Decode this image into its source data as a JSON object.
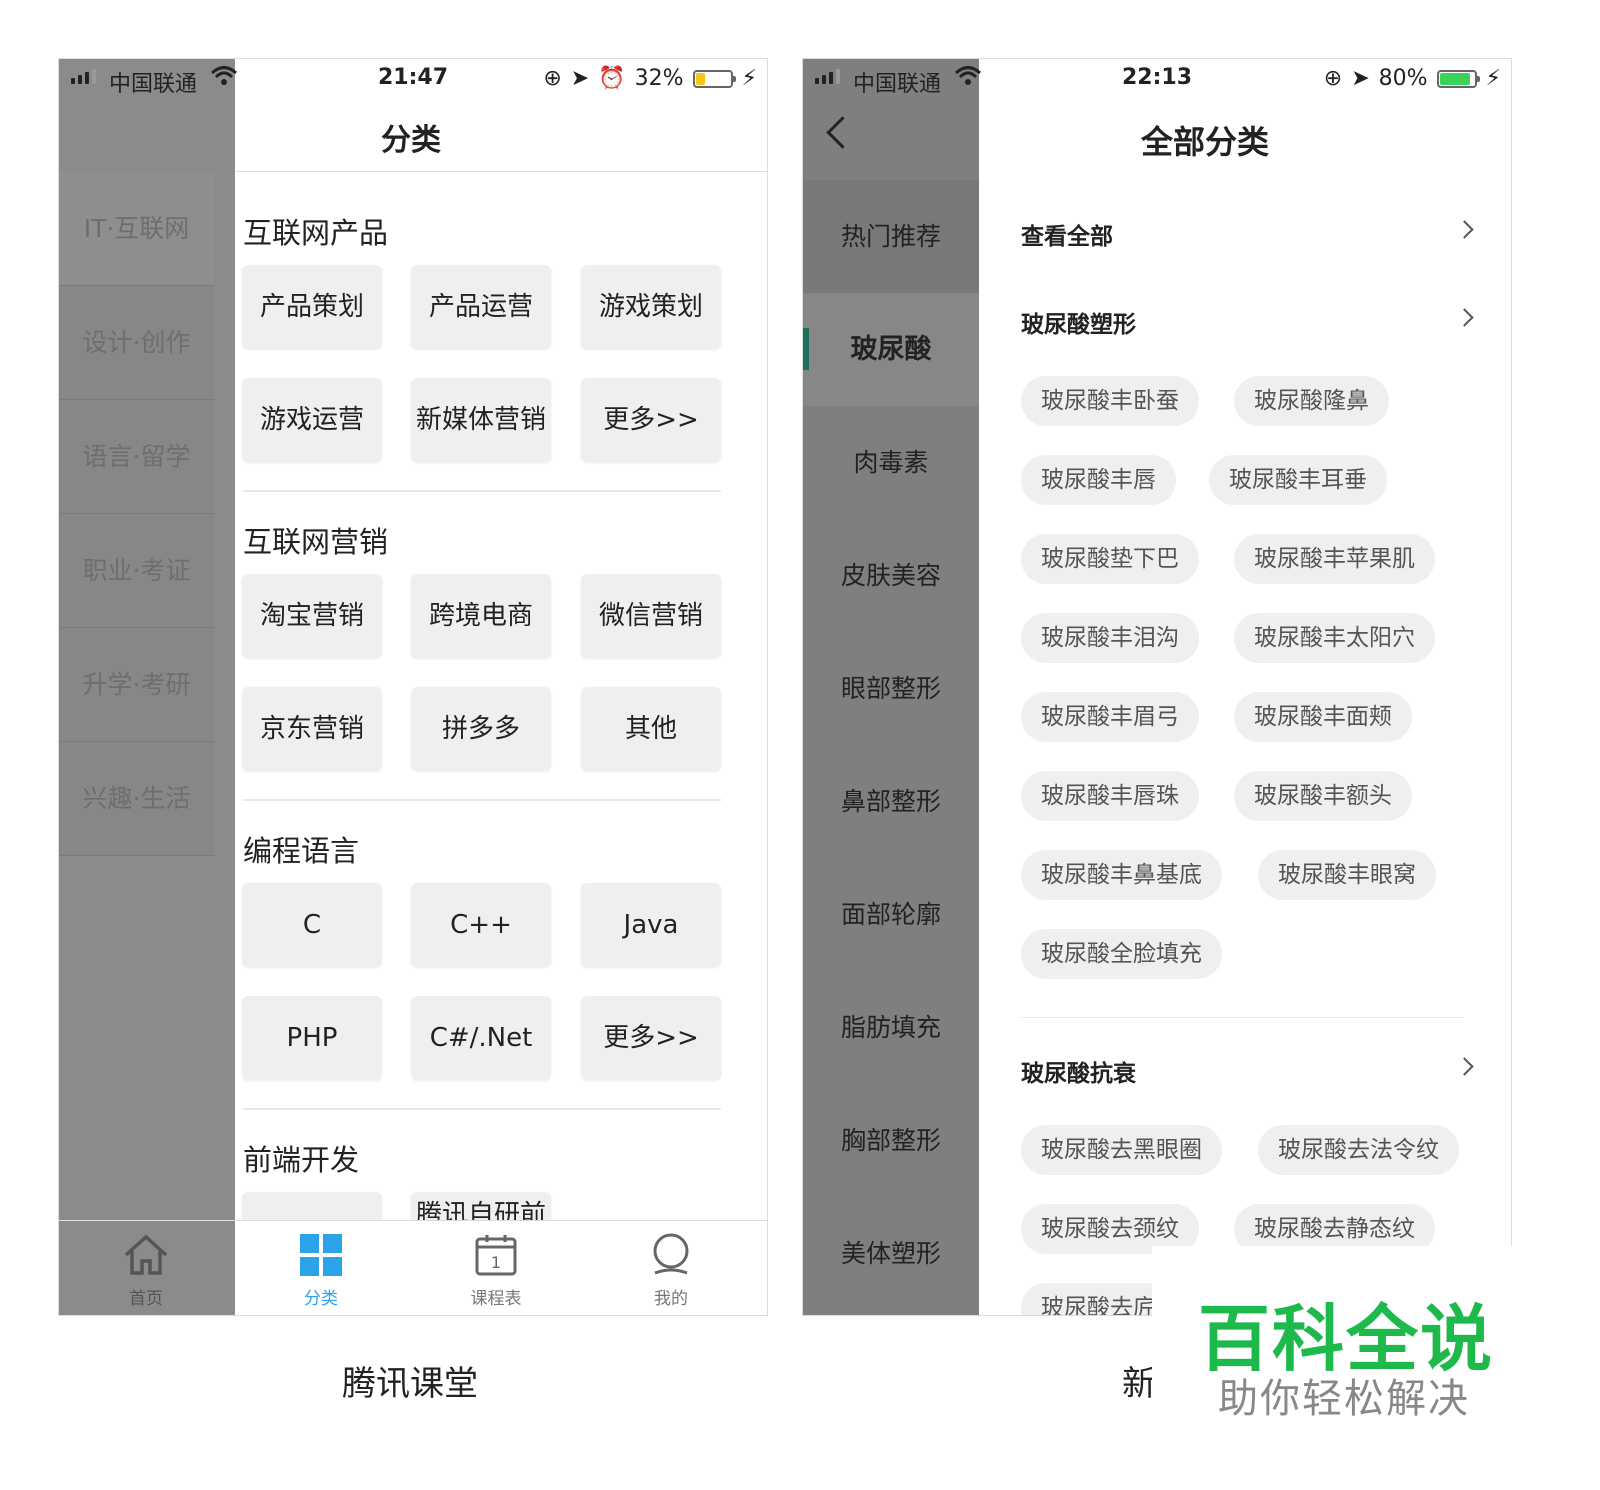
{
  "phoneA": {
    "status": {
      "carrier": "中国联通",
      "time": "21:47",
      "battery": "32%",
      "battery_color": "#f5c518"
    },
    "title": "分类",
    "sidebar": [
      "IT·互联网",
      "设计·创作",
      "语言·留学",
      "职业·考证",
      "升学·考研",
      "兴趣·生活"
    ],
    "sections": [
      {
        "title": "互联网产品",
        "items": [
          "产品策划",
          "产品运营",
          "游戏策划",
          "游戏运营",
          "新媒体营销",
          "更多>>"
        ]
      },
      {
        "title": "互联网营销",
        "items": [
          "淘宝营销",
          "跨境电商",
          "微信营销",
          "京东营销",
          "拼多多",
          "其他"
        ]
      },
      {
        "title": "编程语言",
        "items": [
          "C",
          "C++",
          "Java",
          "PHP",
          "C#/.Net",
          "更多>>"
        ]
      },
      {
        "title": "前端开发",
        "items": [
          "",
          "腾讯自研前"
        ]
      }
    ],
    "tabs": [
      {
        "label": "首页",
        "icon": "home-icon"
      },
      {
        "label": "分类",
        "icon": "grid-icon"
      },
      {
        "label": "课程表",
        "icon": "calendar-icon",
        "day": "1"
      },
      {
        "label": "我的",
        "icon": "user-icon"
      }
    ],
    "accent": "#2aa3e8",
    "caption": "腾讯课堂"
  },
  "phoneB": {
    "status": {
      "carrier": "中国联通",
      "time": "22:13",
      "battery": "80%",
      "battery_color": "#3ad35a"
    },
    "title": "全部分类",
    "sidebar": [
      "热门推荐",
      "玻尿酸",
      "肉毒素",
      "皮肤美容",
      "眼部整形",
      "鼻部整形",
      "面部轮廓",
      "脂肪填充",
      "胸部整形",
      "美体塑形"
    ],
    "active_sidebar": "玻尿酸",
    "view_all": "查看全部",
    "groups": [
      {
        "title": "玻尿酸塑形",
        "chips": [
          "玻尿酸丰卧蚕",
          "玻尿酸隆鼻",
          "玻尿酸丰唇",
          "玻尿酸丰耳垂",
          "玻尿酸垫下巴",
          "玻尿酸丰苹果肌",
          "玻尿酸丰泪沟",
          "玻尿酸丰太阳穴",
          "玻尿酸丰眉弓",
          "玻尿酸丰面颊",
          "玻尿酸丰唇珠",
          "玻尿酸丰额头",
          "玻尿酸丰鼻基底",
          "玻尿酸丰眼窝",
          "玻尿酸全脸填充"
        ]
      },
      {
        "title": "玻尿酸抗衰",
        "chips": [
          "玻尿酸去黑眼圈",
          "玻尿酸去法令纹",
          "玻尿酸去颈纹",
          "玻尿酸去静态纹",
          "玻尿酸去庍"
        ]
      }
    ],
    "caption": "新"
  },
  "watermark": {
    "main": "百科全说",
    "sub": "助你轻松解决",
    "color": "#1db94b"
  }
}
